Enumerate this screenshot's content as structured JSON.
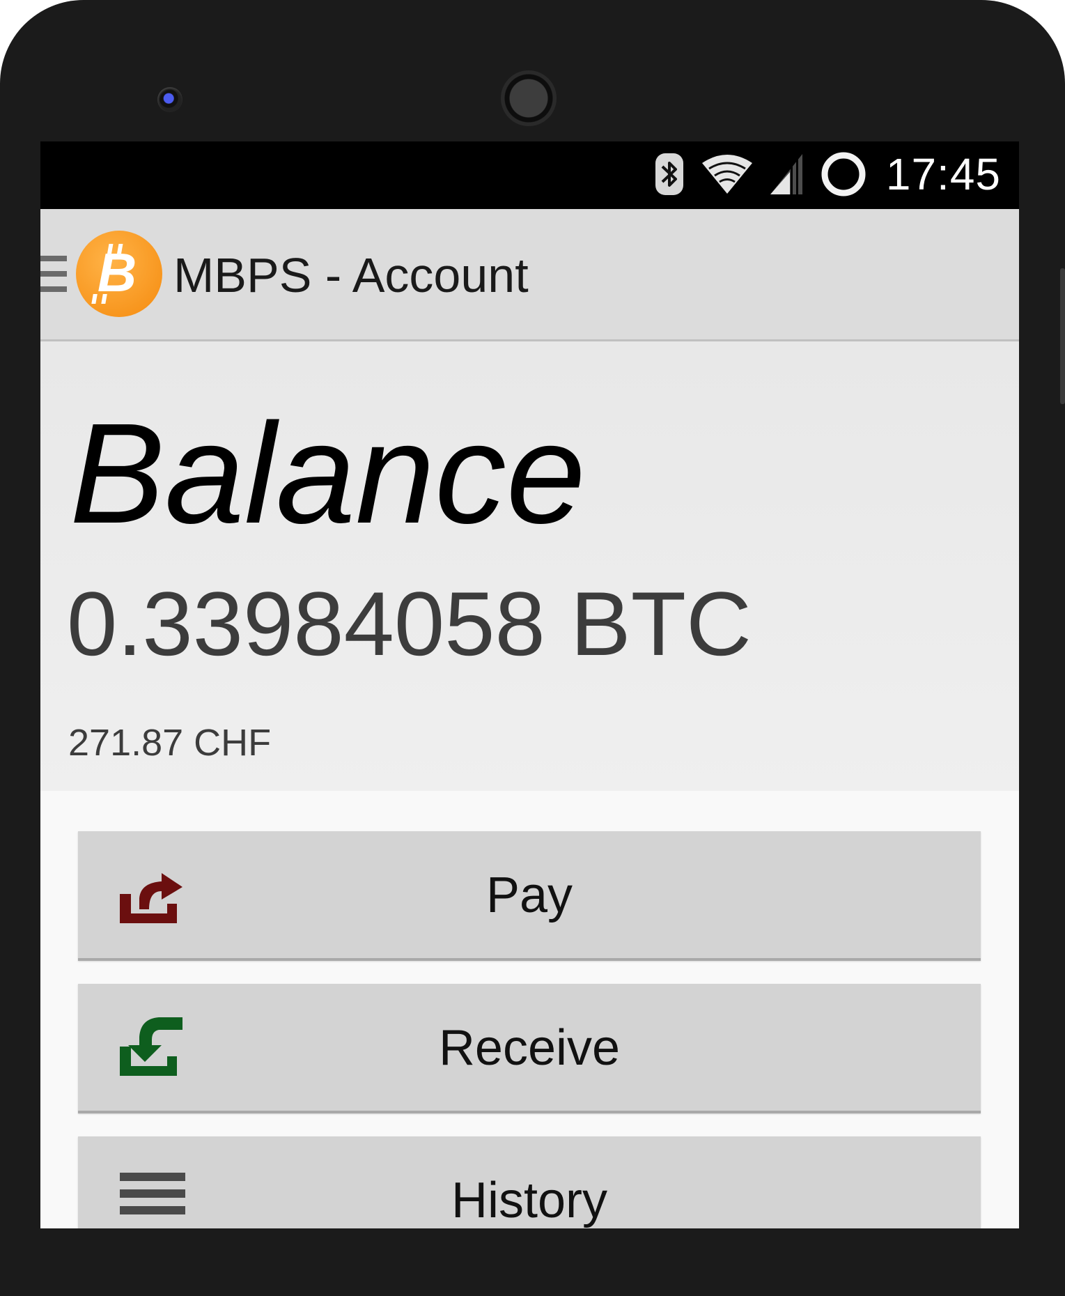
{
  "status_bar": {
    "time": "17:45",
    "icons": [
      "bluetooth-icon",
      "wifi-icon",
      "cell-signal-icon",
      "sync-circle-icon"
    ]
  },
  "action_bar": {
    "menu_icon": "hamburger-menu-icon",
    "logo_icon": "bitcoin-logo-icon",
    "logo_symbol": "B",
    "title": "MBPS - Account",
    "logo_color": "#F7931A"
  },
  "balance": {
    "label": "Balance",
    "btc_amount": "0.33984058 BTC",
    "fiat_amount": "271.87 CHF"
  },
  "buttons": [
    {
      "label": "Pay",
      "icon": "pay-send-arrow-icon",
      "icon_color": "#6B0F0F"
    },
    {
      "label": "Receive",
      "icon": "receive-arrow-icon",
      "icon_color": "#0E5E1E"
    },
    {
      "label": "History",
      "icon": "history-list-icon",
      "icon_color": "#4A4A4A"
    }
  ]
}
